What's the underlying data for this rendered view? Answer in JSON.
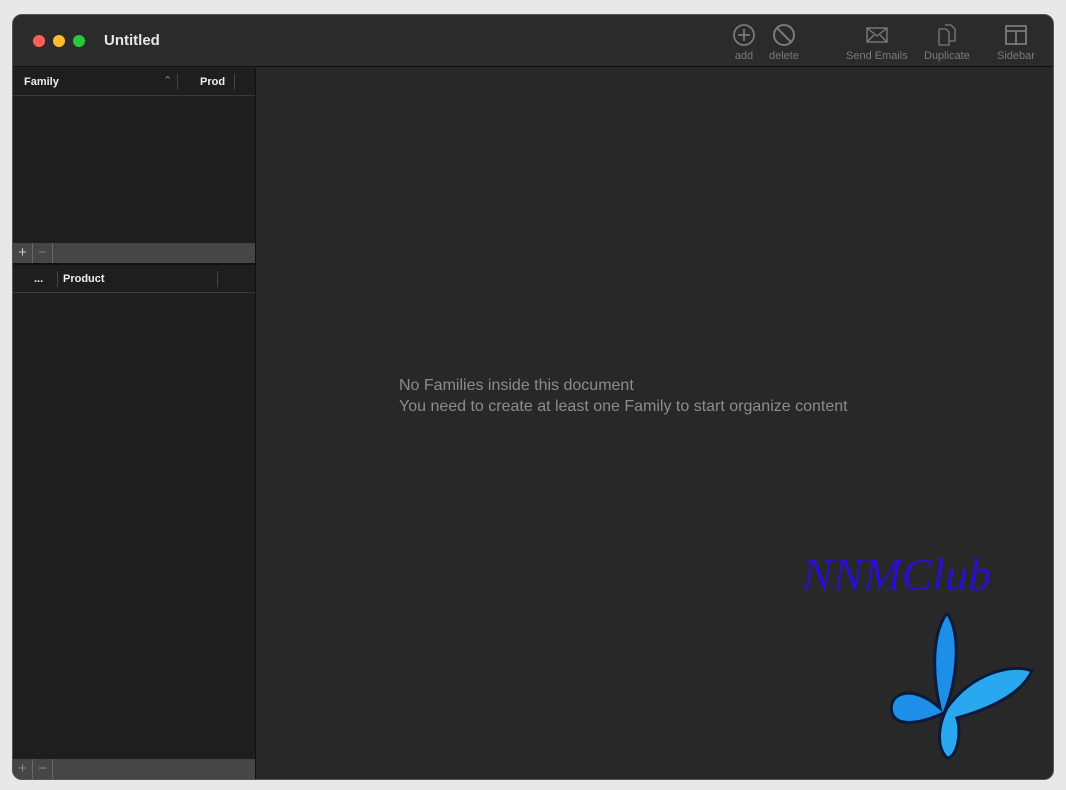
{
  "window": {
    "title": "Untitled"
  },
  "toolbar": {
    "add": "add",
    "delete": "delete",
    "send_emails": "Send Emails",
    "duplicate": "Duplicate",
    "sidebar": "Sidebar"
  },
  "families_table": {
    "columns": [
      "Family",
      "Prod"
    ]
  },
  "products_table": {
    "columns": [
      "...",
      "Product"
    ]
  },
  "buttons": {
    "add": "+",
    "remove": "−"
  },
  "main": {
    "empty_line1": "No Families inside this document",
    "empty_line2": "You need to create at least one Family to start organize content"
  },
  "watermark": {
    "text": "NNMClub"
  },
  "colors": {
    "close": "#fe5f57",
    "minimize": "#febc2e",
    "zoom": "#28c840",
    "watermark": "#2a10c8"
  }
}
